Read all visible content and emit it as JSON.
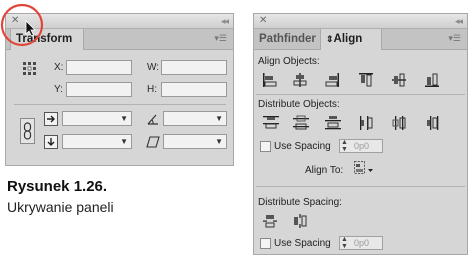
{
  "transform_panel": {
    "tab": "Transform",
    "labels": {
      "x": "X:",
      "y": "Y:",
      "w": "W:",
      "h": "H:"
    }
  },
  "align_panel": {
    "tabs": [
      "Pathfinder",
      "Align"
    ],
    "align_objects": "Align Objects:",
    "distribute_objects": "Distribute Objects:",
    "use_spacing": "Use Spacing",
    "spacing_value": "0p0",
    "align_to": "Align To:",
    "distribute_spacing": "Distribute Spacing:",
    "use_spacing2": "Use Spacing",
    "spacing_value2": "0p0"
  },
  "caption": {
    "title": "Rysunek 1.26.",
    "subtitle": "Ukrywanie paneli"
  },
  "colors": {
    "highlight_circle": "#e0473a",
    "panel_bg": "#d6d6d6"
  }
}
